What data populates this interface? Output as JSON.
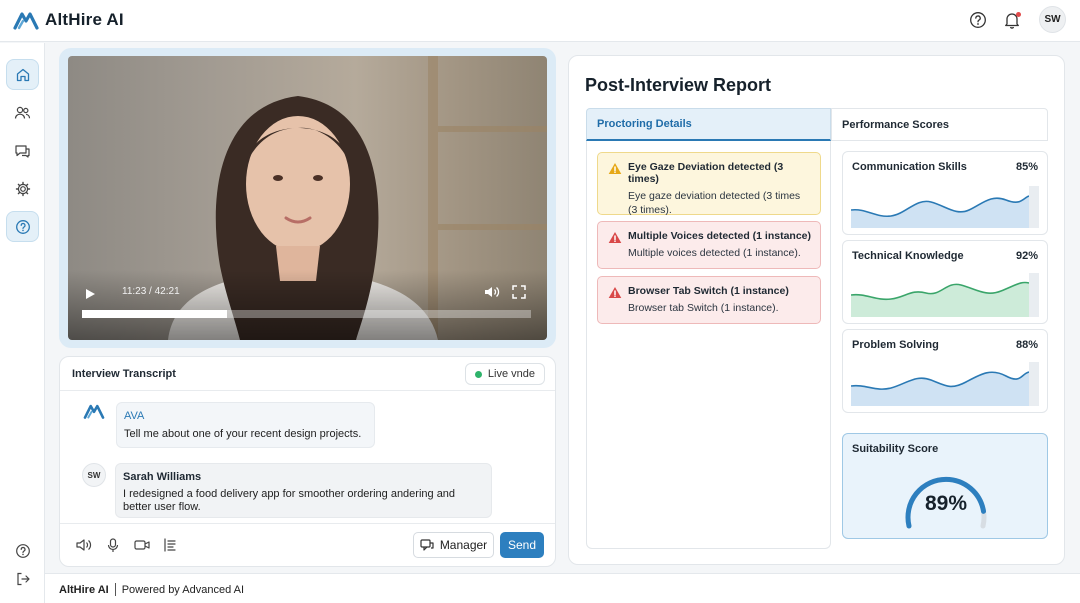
{
  "header": {
    "brand": "AltHire AI",
    "user_initials": "SW",
    "icons": [
      "help-icon",
      "bell-icon"
    ]
  },
  "sidebar": {
    "items": [
      {
        "name": "home",
        "icon": "home-icon",
        "active": true
      },
      {
        "name": "candidates",
        "icon": "users-icon"
      },
      {
        "name": "messages",
        "icon": "chat-icon"
      },
      {
        "name": "settings",
        "icon": "gear-icon"
      },
      {
        "name": "support",
        "icon": "help-circle-icon"
      }
    ],
    "bottom": [
      {
        "name": "help",
        "icon": "question-icon"
      },
      {
        "name": "logout",
        "icon": "logout-icon"
      }
    ]
  },
  "video": {
    "time": "11:23 / 42:21",
    "progress": 0.323
  },
  "transcript": {
    "title": "Interview Transcript",
    "live_label": "Live vnde",
    "messages": [
      {
        "speaker": "AVA",
        "text": "Tell me about one of your recent design projects."
      },
      {
        "speaker": "Sarah Williams",
        "initials": "SW",
        "text": "I redesigned a food delivery app for smoother ordering andering and better user flow."
      }
    ],
    "manager_label": "Manager",
    "send_label": "Send"
  },
  "report": {
    "title": "Post-Interview Report",
    "tabs": [
      {
        "label": "Proctoring Details",
        "active": true
      },
      {
        "label": "Performance Scores"
      }
    ],
    "alerts": [
      {
        "severity": "warning",
        "title": "Eye Gaze Deviation detected (3 times)",
        "detail": "Eye gaze deviation detected (3 times (3 times)."
      },
      {
        "severity": "error",
        "title": "Multiple Voices detected (1 instance)",
        "detail": "Multiple voices detected (1 instance)."
      },
      {
        "severity": "error",
        "title": "Browser Tab Switch (1 instance)",
        "detail": "Browser tab Switch (1 instance)."
      }
    ],
    "scores": [
      {
        "label": "Communication Skills",
        "value": "85%",
        "color": "#2a79b4",
        "fill": "#cfe2f3"
      },
      {
        "label": "Technical Knowledge",
        "value": "92%",
        "color": "#3aa56a",
        "fill": "#cdebd9"
      },
      {
        "label": "Problem Solving",
        "value": "88%",
        "color": "#2a79b4",
        "fill": "#cfe2f3"
      }
    ],
    "suitability": {
      "label": "Suitability Score",
      "value": "89%",
      "fraction": 0.89
    }
  },
  "footer": {
    "brand": "AltHire AI",
    "tagline": "Powered by Advanced AI"
  },
  "colors": {
    "accent": "#2d7fbf",
    "warning": "#e6a817",
    "error": "#d94848",
    "success": "#2fb36b"
  }
}
